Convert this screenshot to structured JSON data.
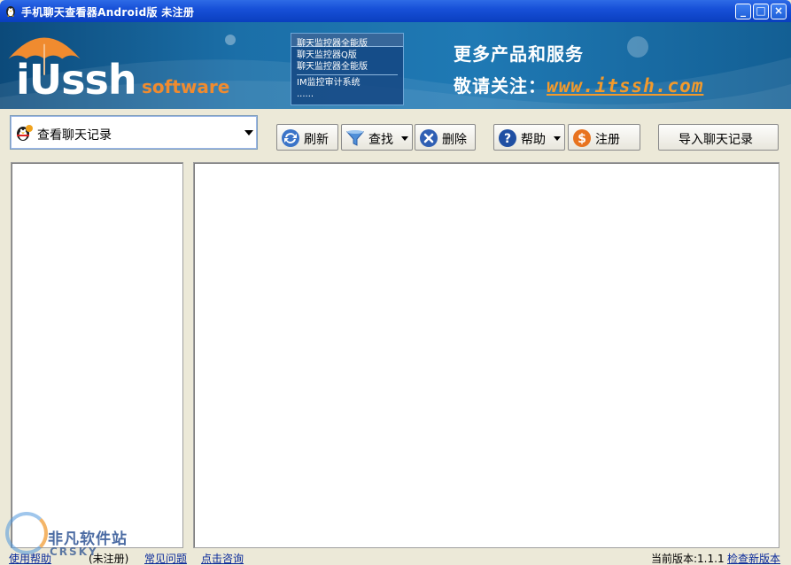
{
  "window": {
    "title": "手机聊天查看器Android版 未注册",
    "controls": {
      "minimize": "_",
      "maximize": "□",
      "close": "×"
    }
  },
  "banner": {
    "logo_main": "iUssh",
    "logo_sub": "software",
    "product_menu": {
      "header": "聊天监控器全能版",
      "items": [
        "聊天监控器Q版",
        "聊天监控器全能版",
        "IM监控审计系统",
        "......"
      ]
    },
    "promo_line1": "更多产品和服务",
    "promo_line2_prefix": "敬请关注：",
    "promo_url": "www.itssh.com"
  },
  "toolbar": {
    "view_select": {
      "selected": "查看聊天记录",
      "icon": "qq-penguin-icon"
    },
    "refresh_label": "刷新",
    "search_label": "查找",
    "delete_label": "删除",
    "help_label": "帮助",
    "register_label": "注册",
    "import_label": "导入聊天记录"
  },
  "statusbar": {
    "links": [
      "使用帮助",
      "常见问题",
      "点击咨询"
    ],
    "register_status": "(未注册)",
    "version_label": "当前版本:1.1.1",
    "check_update": "检查新版本"
  },
  "watermark": {
    "text": "非凡软件站",
    "sub": "CRSKY"
  },
  "colors": {
    "titlebar": "#1750d8",
    "banner": "#1b6fa8",
    "accent_orange": "#f39a2b",
    "link": "#0a2a9a"
  }
}
